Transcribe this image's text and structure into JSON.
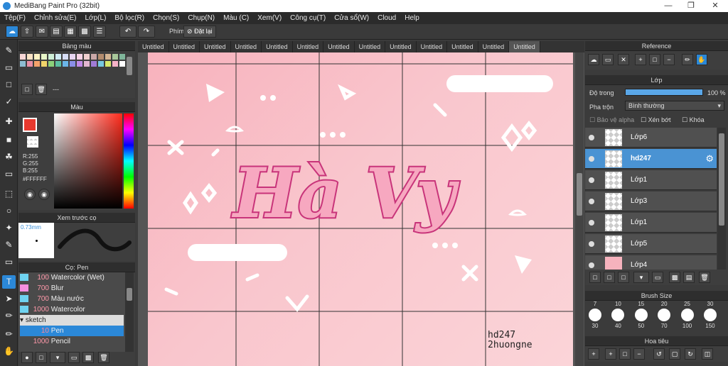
{
  "app": {
    "title": "MediBang Paint Pro (32bit)"
  },
  "menu": [
    "Tệp(F)",
    "Chỉnh sửa(E)",
    "Lớp(L)",
    "Bộ lọc(R)",
    "Chọn(S)",
    "Chụp(N)",
    "Màu (C)",
    "Xem(V)",
    "Công cụ(T)",
    "Cửa sổ(W)",
    "Cloud",
    "Help"
  ],
  "toolbar": {
    "shortcut_label": "Phím",
    "reset_label": "Đặt lại"
  },
  "palette": {
    "title": "Bảng màu",
    "dash": "---",
    "swatches": [
      "#f7d6d6",
      "#f9e2c4",
      "#fff3c4",
      "#e8f6c8",
      "#cdeed6",
      "#cfeaf3",
      "#d6ddf6",
      "#e8d6f3",
      "#f6d3e6",
      "#f0d0d0",
      "#c9a7a7",
      "#b38c6e",
      "#d4b493",
      "#a8c79a",
      "#7fb59a",
      "#8dbcd1",
      "#e88fa6",
      "#f4a26b",
      "#f0d46a",
      "#8cd17a",
      "#5cbfa1",
      "#6bb5e8",
      "#8a8ee8",
      "#c18ae8",
      "#e2b6d0",
      "#a07bd5",
      "#77c9e0",
      "#d7e86a",
      "#f6b2c7",
      "#ffffff"
    ]
  },
  "color": {
    "title": "Màu",
    "r": "R:255",
    "g": "G:255",
    "b": "B:255",
    "hex": "#FFFFFF",
    "fg": "#e8392e"
  },
  "preview": {
    "title": "Xem trước cọ",
    "size": "0.73mm"
  },
  "brush": {
    "title": "Cọ: Pen",
    "items": [
      {
        "size": "100",
        "name": "Watercolor (Wet)",
        "color": "#6fd3f0"
      },
      {
        "size": "700",
        "name": "Blur",
        "color": "#f48fe0"
      },
      {
        "size": "700",
        "name": "Màu nước",
        "color": "#6fd3f0"
      },
      {
        "size": "1000",
        "name": "Watercolor",
        "color": "#6fd3f0"
      }
    ],
    "group": "sketch",
    "selected": {
      "size": "10",
      "name": "Pen"
    },
    "after": {
      "size": "1000",
      "name": "Pencil"
    }
  },
  "tabs": [
    "Untitled",
    "Untitled",
    "Untitled",
    "Untitled",
    "Untitled",
    "Untitled",
    "Untitled",
    "Untitled",
    "Untitled",
    "Untitled",
    "Untitled",
    "Untitled",
    "Untitled"
  ],
  "artwork": {
    "title_text": "Hà Vy",
    "credit_line1": "hd247",
    "credit_line2": "2huongne"
  },
  "reference": {
    "title": "Reference"
  },
  "layer": {
    "title": "Lớp",
    "opacity_label": "Độ trong",
    "opacity_value": "100 %",
    "blend_label": "Pha trộn",
    "blend_value": "Bình thường",
    "protect_alpha": "Bảo vệ alpha",
    "clip": "Xén bớt",
    "lock": "Khóa",
    "layers": [
      {
        "name": "Lớp6"
      },
      {
        "name": "hd247"
      },
      {
        "name": "Lớp1"
      },
      {
        "name": "Lớp3"
      },
      {
        "name": "Lớp1"
      },
      {
        "name": "Lớp5"
      },
      {
        "name": "Lớp4"
      }
    ]
  },
  "brushsize": {
    "title": "Brush Size",
    "top": [
      "7",
      "10",
      "15",
      "20",
      "25",
      "30"
    ],
    "bottom": [
      "30",
      "40",
      "50",
      "70",
      "100",
      "150"
    ]
  },
  "navigator": {
    "title": "Hoa tiêu"
  }
}
